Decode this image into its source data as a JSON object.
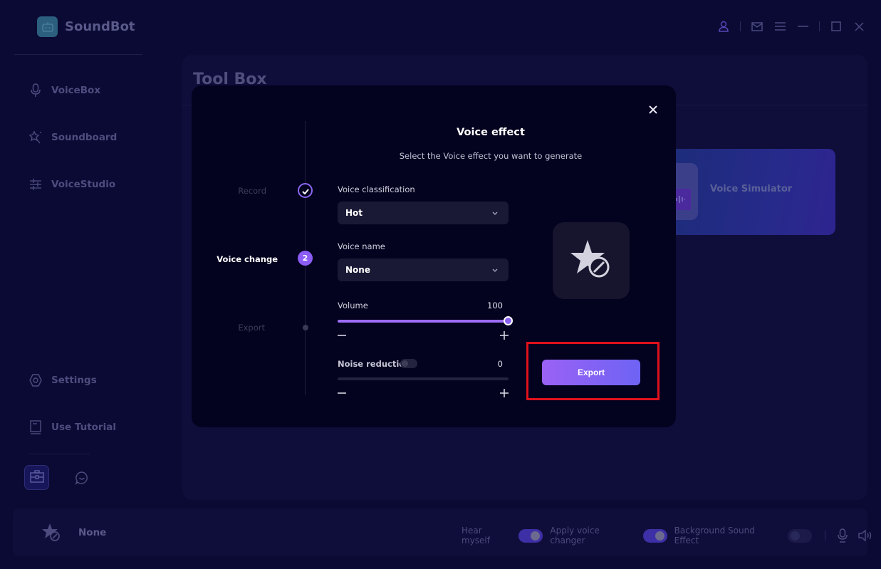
{
  "app": {
    "title": "SoundBot",
    "brand_color": "#8b5cf6"
  },
  "window_controls": {
    "icons": [
      "user-icon",
      "mail-icon",
      "menu-icon",
      "minimize-icon",
      "maximize-icon",
      "close-icon"
    ]
  },
  "sidebar": {
    "items": [
      {
        "label": "VoiceBox",
        "icon": "microphone-icon"
      },
      {
        "label": "Soundboard",
        "icon": "magic-wand-icon"
      },
      {
        "label": "VoiceStudio",
        "icon": "sliders-icon"
      },
      {
        "label": "Settings",
        "icon": "gear-icon"
      },
      {
        "label": "Use Tutorial",
        "icon": "book-icon"
      }
    ],
    "bottom_icons": [
      "toolbox-icon",
      "chat-icon"
    ]
  },
  "main": {
    "title": "Tool Box",
    "cards": [
      {
        "label": "Voice Simulator"
      }
    ]
  },
  "modal": {
    "title": "Voice effect",
    "subtitle": "Select the Voice effect you want to generate",
    "steps": [
      {
        "label": "Record",
        "state": "done"
      },
      {
        "label": "Voice change",
        "state": "active",
        "number": "2"
      },
      {
        "label": "Export",
        "state": "pending"
      }
    ],
    "voice_classification": {
      "label": "Voice classification",
      "value": "Hot"
    },
    "voice_name": {
      "label": "Voice name",
      "value": "None"
    },
    "volume": {
      "label": "Volume",
      "value": "100",
      "fraction": 1.0
    },
    "noise_reduction": {
      "label": "Noise reduction",
      "value": "0",
      "fraction": 0.0,
      "enabled": false
    },
    "minus_symbol": "−",
    "plus_symbol": "+",
    "export_label": "Export"
  },
  "bottom_bar": {
    "current_voice": "None",
    "hear_myself": {
      "label": "Hear myself",
      "on": true
    },
    "apply_voice_changer": {
      "label": "Apply voice changer",
      "on": true
    },
    "background_sound_effect": {
      "label": "Background Sound Effect",
      "on": false
    }
  }
}
